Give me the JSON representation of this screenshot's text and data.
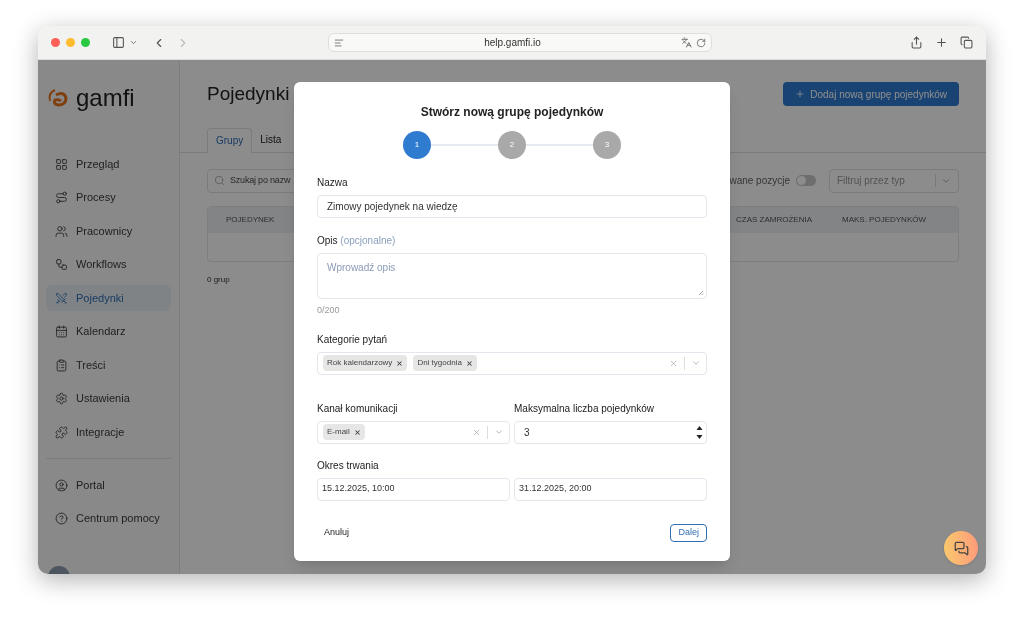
{
  "browser": {
    "url": "help.gamfi.io"
  },
  "sidebar": {
    "logo": "gamfi",
    "items": [
      {
        "label": "Przegląd",
        "selected": false
      },
      {
        "label": "Procesy",
        "selected": false
      },
      {
        "label": "Pracownicy",
        "selected": false
      },
      {
        "label": "Workflows",
        "selected": false
      },
      {
        "label": "Pojedynki",
        "selected": true
      },
      {
        "label": "Kalendarz",
        "selected": false
      },
      {
        "label": "Treści",
        "selected": false
      },
      {
        "label": "Ustawienia",
        "selected": false
      },
      {
        "label": "Integracje",
        "selected": false
      }
    ],
    "footer_items": [
      {
        "label": "Portal",
        "selected": false
      },
      {
        "label": "Centrum pomocy",
        "selected": false
      }
    ]
  },
  "page": {
    "title": "Pojedynki",
    "add_button": "Dodaj nową grupę pojedynków",
    "tabs": [
      {
        "label": "Grupy",
        "selected": true
      },
      {
        "label": "Lista",
        "selected": false
      }
    ],
    "search": {
      "placeholder": "Szukaj po nazw"
    },
    "toggle": {
      "label": "wane pozycje",
      "on": false
    },
    "filter": {
      "placeholder": "Filtruj przez typ"
    },
    "table": {
      "columns": [
        "POJEDYNEK",
        "CZAS ZAMROŻENIA",
        "MAKS. POJEDYNKÓW"
      ]
    },
    "count": "0 grup"
  },
  "modal": {
    "title": "Stwórz nową grupę pojedynków",
    "steps": [
      {
        "label": "1",
        "selected": true
      },
      {
        "label": "2",
        "selected": false
      },
      {
        "label": "3",
        "selected": false
      }
    ],
    "name": {
      "label": "Nazwa",
      "value": "Zimowy pojedynek na wiedzę"
    },
    "description": {
      "label": "Opis",
      "hint": "(opcjonalne)",
      "placeholder": "Wprowadź opis",
      "counter": "0/200"
    },
    "categories": {
      "label": "Kategorie pytań",
      "tags": [
        "Rok kalendarzowy",
        "Dni tygodnia"
      ]
    },
    "channel": {
      "label": "Kanał komunikacji",
      "tags": [
        "E-mail"
      ]
    },
    "max_duels": {
      "label": "Maksymalna liczba pojedynków",
      "value": "3"
    },
    "period": {
      "label": "Okres trwania",
      "start": "15.12.2025, 10:00",
      "end": "31.12.2025, 20:00"
    },
    "cancel": "Anuluj",
    "next": "Dalej"
  }
}
